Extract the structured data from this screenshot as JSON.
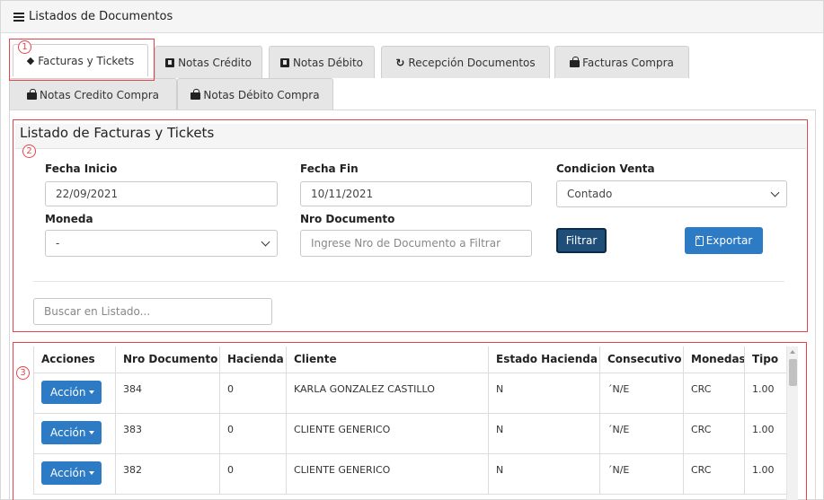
{
  "header": {
    "title": "Listados de Documentos",
    "icon": "list-icon"
  },
  "tabs": [
    {
      "label": "Facturas y Tickets",
      "icon": "ticket-icon",
      "active": true
    },
    {
      "label": "Notas Crédito",
      "icon": "book-icon"
    },
    {
      "label": "Notas Débito",
      "icon": "book-icon"
    },
    {
      "label": "Recepción Documentos",
      "icon": "refresh-icon"
    },
    {
      "label": "Facturas Compra",
      "icon": "shopping-bag-icon"
    },
    {
      "label": "Notas Credito Compra",
      "icon": "shopping-bag-icon"
    },
    {
      "label": "Notas Débito Compra",
      "icon": "shopping-bag-icon"
    }
  ],
  "section": {
    "title": "Listado de Facturas y Tickets"
  },
  "filters": {
    "fecha_inicio": {
      "label": "Fecha Inicio",
      "value": "22/09/2021"
    },
    "fecha_fin": {
      "label": "Fecha Fin",
      "value": "10/11/2021"
    },
    "condicion_venta": {
      "label": "Condicion Venta",
      "value": "Contado"
    },
    "moneda": {
      "label": "Moneda",
      "value": "-"
    },
    "nro_documento": {
      "label": "Nro Documento",
      "placeholder": "Ingrese Nro de Documento a Filtrar"
    },
    "filtrar_label": "Filtrar",
    "exportar_label": "Exportar"
  },
  "search": {
    "placeholder": "Buscar en Listado..."
  },
  "table": {
    "columns": [
      "Acciones",
      "Nro Documento",
      "Hacienda",
      "Cliente",
      "Estado Hacienda",
      "Consecutivo",
      "Monedas",
      "Tipo"
    ],
    "action_label": "Acción",
    "rows": [
      {
        "nro": "384",
        "hacienda": "0",
        "cliente": "KARLA GONZALEZ CASTILLO",
        "estado": "N",
        "consecutivo": "´N/E",
        "moneda": "CRC",
        "tipo": "1.00"
      },
      {
        "nro": "383",
        "hacienda": "0",
        "cliente": "CLIENTE GENERICO",
        "estado": "N",
        "consecutivo": "´N/E",
        "moneda": "CRC",
        "tipo": "1.00"
      },
      {
        "nro": "382",
        "hacienda": "0",
        "cliente": "CLIENTE GENERICO",
        "estado": "N",
        "consecutivo": "´N/E",
        "moneda": "CRC",
        "tipo": "1.00"
      }
    ]
  },
  "annotations": [
    "1",
    "2",
    "3"
  ],
  "colors": {
    "annotation_red": "#e8434b",
    "primary_blue": "#2d7bc4",
    "dark_blue": "#1f4e79"
  }
}
